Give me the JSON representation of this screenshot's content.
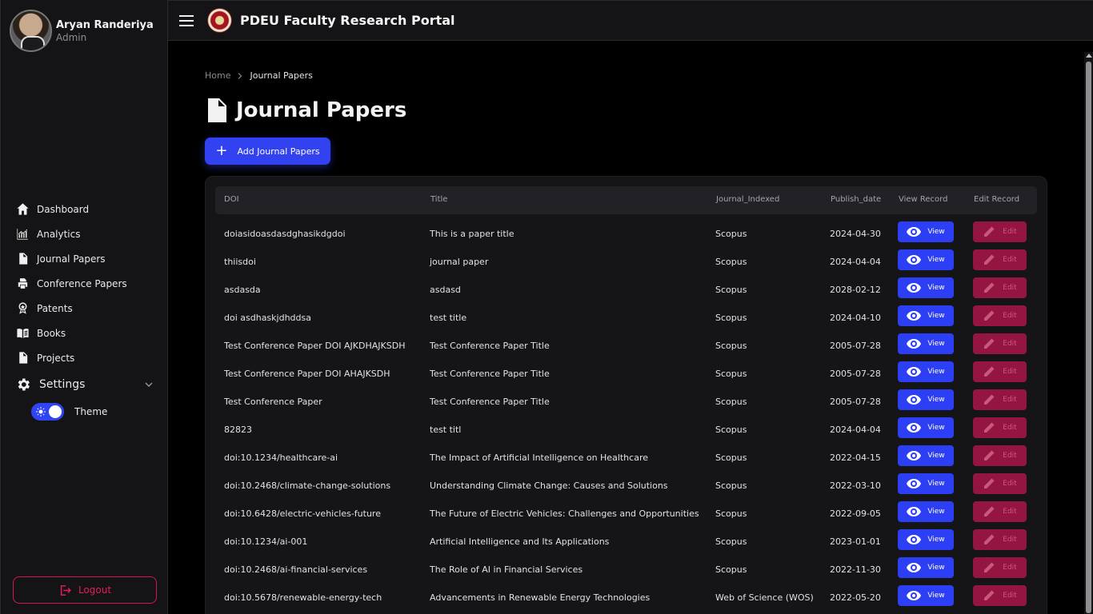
{
  "profile": {
    "name": "Aryan Randeriya",
    "role": "Admin"
  },
  "header": {
    "title": "PDEU Faculty Research Portal"
  },
  "sidebar": {
    "items": [
      {
        "label": "Dashboard",
        "icon": "home-icon"
      },
      {
        "label": "Analytics",
        "icon": "chart-icon"
      },
      {
        "label": "Journal Papers",
        "icon": "document-icon"
      },
      {
        "label": "Conference Papers",
        "icon": "printer-icon"
      },
      {
        "label": "Patents",
        "icon": "award-icon"
      },
      {
        "label": "Books",
        "icon": "book-icon"
      },
      {
        "label": "Projects",
        "icon": "checklist-icon"
      }
    ],
    "settings_label": "Settings",
    "theme_label": "Theme",
    "logout_label": "Logout"
  },
  "breadcrumb": {
    "home": "Home",
    "current": "Journal Papers"
  },
  "page": {
    "title": "Journal Papers",
    "add_button": "Add Journal Papers"
  },
  "table": {
    "headers": [
      "DOI",
      "Title",
      "Journal_Indexed",
      "Publish_date",
      "View Record",
      "Edit Record"
    ],
    "view_label": "View",
    "edit_label": "Edit",
    "rows": [
      {
        "doi": "doiasidoasdasdghasikdgdoi",
        "title": "This is a paper title",
        "indexed": "Scopus",
        "date": "2024-04-30"
      },
      {
        "doi": "thiisdoi",
        "title": "journal paper",
        "indexed": "Scopus",
        "date": "2024-04-04"
      },
      {
        "doi": "asdasda",
        "title": "asdasd",
        "indexed": "Scopus",
        "date": "2028-02-12"
      },
      {
        "doi": "doi asdhaskjdhddsa",
        "title": "test title",
        "indexed": "Scopus",
        "date": "2024-04-10"
      },
      {
        "doi": "Test Conference Paper DOI AJKDHAJKSDH",
        "title": "Test Conference Paper Title",
        "indexed": "Scopus",
        "date": "2005-07-28"
      },
      {
        "doi": "Test Conference Paper DOI AHAJKSDH",
        "title": "Test Conference Paper Title",
        "indexed": "Scopus",
        "date": "2005-07-28"
      },
      {
        "doi": "Test Conference Paper",
        "title": "Test Conference Paper Title",
        "indexed": "Scopus",
        "date": "2005-07-28"
      },
      {
        "doi": "82823",
        "title": "test titl",
        "indexed": "Scopus",
        "date": "2024-04-04"
      },
      {
        "doi": "doi:10.1234/healthcare-ai",
        "title": "The Impact of Artificial Intelligence on Healthcare",
        "indexed": "Scopus",
        "date": "2022-04-15"
      },
      {
        "doi": "doi:10.2468/climate-change-solutions",
        "title": "Understanding Climate Change: Causes and Solutions",
        "indexed": "Scopus",
        "date": "2022-03-10"
      },
      {
        "doi": "doi:10.6428/electric-vehicles-future",
        "title": "The Future of Electric Vehicles: Challenges and Opportunities",
        "indexed": "Scopus",
        "date": "2022-09-05"
      },
      {
        "doi": "doi:10.1234/ai-001",
        "title": "Artificial Intelligence and Its Applications",
        "indexed": "Scopus",
        "date": "2023-01-01"
      },
      {
        "doi": "doi:10.2468/ai-financial-services",
        "title": "The Role of AI in Financial Services",
        "indexed": "Scopus",
        "date": "2022-11-30"
      },
      {
        "doi": "doi:10.5678/renewable-energy-tech",
        "title": "Advancements in Renewable Energy Technologies",
        "indexed": "Web of Science (WOS)",
        "date": "2022-05-20"
      }
    ]
  },
  "colors": {
    "accent": "#2c3ff5",
    "danger": "#941541",
    "logout": "#e81c5a"
  }
}
